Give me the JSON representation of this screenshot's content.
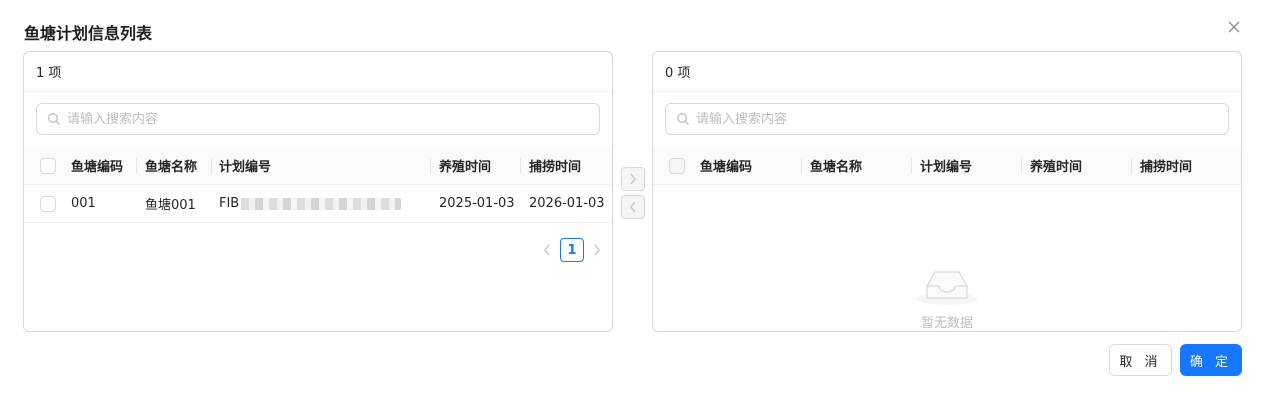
{
  "modal": {
    "title": "鱼塘计划信息列表",
    "close_icon": "close-icon"
  },
  "left_panel": {
    "count_label": "1 项",
    "search_placeholder": "请输入搜索内容",
    "columns": [
      "鱼塘编码",
      "鱼塘名称",
      "计划编号",
      "养殖时间",
      "捕捞时间"
    ],
    "rows": [
      {
        "code": "001",
        "name": "鱼塘001",
        "plan_prefix": "FIB",
        "plan_redacted": true,
        "breed_time": "2025-01-03",
        "catch_time": "2026-01-03"
      }
    ],
    "pagination": {
      "current_page": "1",
      "prev_icon": "chevron-left-icon",
      "next_icon": "chevron-right-icon"
    }
  },
  "transfer": {
    "to_right_icon": "chevron-right-icon",
    "to_left_icon": "chevron-left-icon"
  },
  "right_panel": {
    "count_label": "0 项",
    "search_placeholder": "请输入搜索内容",
    "columns": [
      "鱼塘编码",
      "鱼塘名称",
      "计划编号",
      "养殖时间",
      "捕捞时间"
    ],
    "empty_text": "暂无数据",
    "empty_icon": "empty-inbox-icon"
  },
  "footer": {
    "cancel_label": "取 消",
    "ok_label": "确 定"
  },
  "colors": {
    "primary": "#1677ff",
    "border": "#d9d9d9",
    "header_bg": "#fafafa",
    "placeholder": "#bfbfbf"
  }
}
